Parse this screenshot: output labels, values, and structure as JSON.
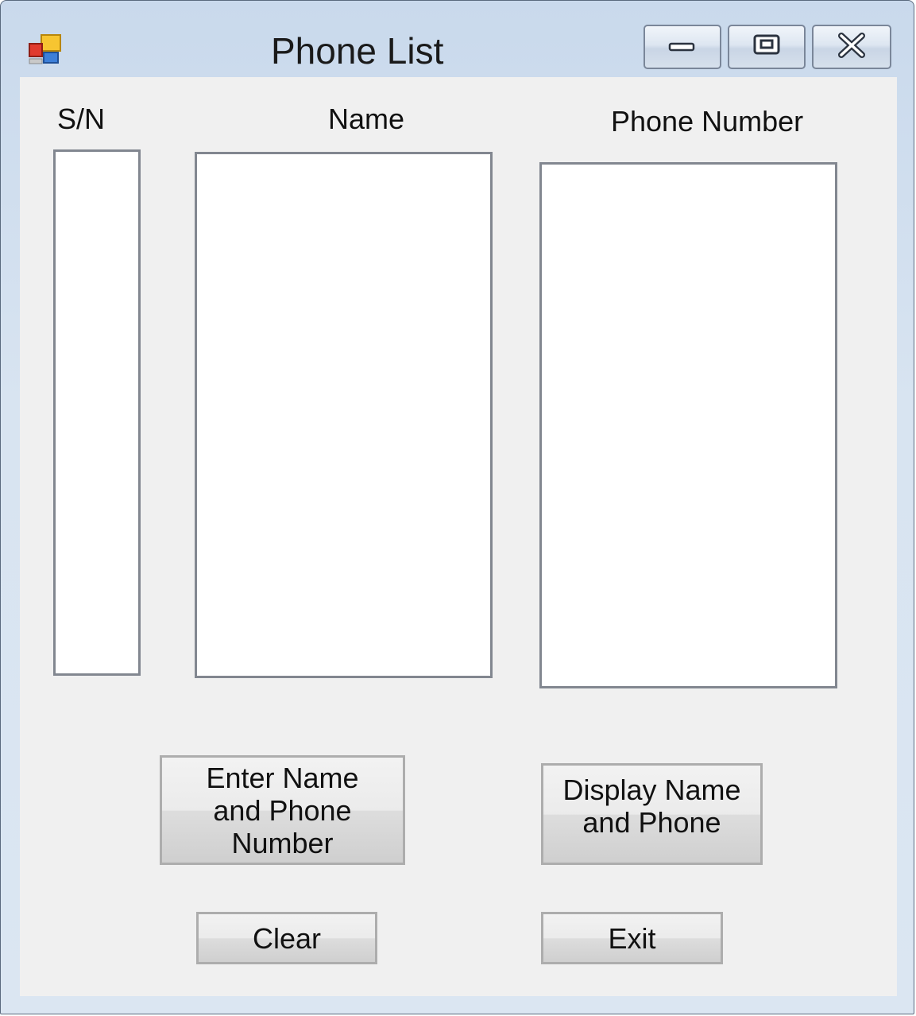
{
  "window": {
    "title": "Phone List",
    "controls": {
      "minimize": "minimize",
      "maximize": "maximize",
      "close": "close"
    }
  },
  "labels": {
    "sn": "S/N",
    "name": "Name",
    "phone": "Phone Number"
  },
  "buttons": {
    "enter": "Enter Name and Phone Number",
    "display": "Display Name and Phone",
    "clear": "Clear",
    "exit": "Exit"
  },
  "icons": {
    "app": "app-form-icon",
    "minimize": "minimize-icon",
    "maximize": "maximize-icon",
    "close": "close-icon"
  },
  "colors": {
    "titlebar": "#d8e4f1",
    "client_background": "#f0f0f0",
    "listbox_border": "#828790",
    "button_border": "#adadad"
  }
}
